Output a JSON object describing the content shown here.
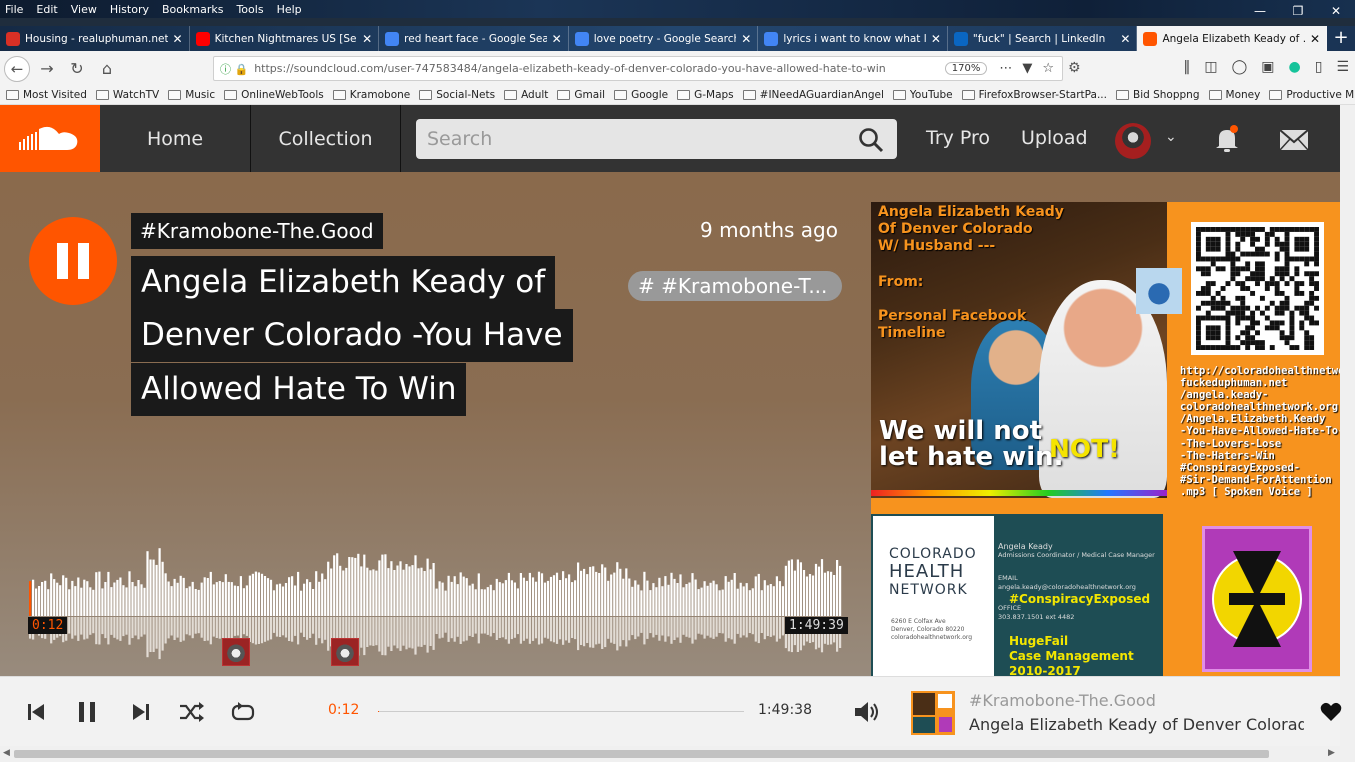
{
  "browser": {
    "menu": [
      "File",
      "Edit",
      "View",
      "History",
      "Bookmarks",
      "Tools",
      "Help"
    ],
    "tabs": [
      {
        "title": "Housing - realuphuman.net@...",
        "favicon": "gmail-icon",
        "color": "#d93025"
      },
      {
        "title": "Kitchen Nightmares US [Se...",
        "favicon": "youtube-icon",
        "color": "#ff0000"
      },
      {
        "title": "red heart face - Google Search",
        "favicon": "google-icon",
        "color": "#4285f4"
      },
      {
        "title": "love poetry - Google Search",
        "favicon": "google-icon",
        "color": "#4285f4"
      },
      {
        "title": "lyrics i want to know what lov...",
        "favicon": "google-icon",
        "color": "#4285f4"
      },
      {
        "title": "\"fuck\" | Search | LinkedIn",
        "favicon": "linkedin-icon",
        "color": "#0a66c2"
      },
      {
        "title": "Angela Elizabeth Keady of ...",
        "favicon": "soundcloud-icon",
        "color": "#ff5500"
      }
    ],
    "url": "https://soundcloud.com/user-747583484/angela-elizabeth-keady-of-denver-colorado-you-have-allowed-hate-to-win",
    "zoom": "170%",
    "bookmarks": [
      "Most Visited",
      "WatchTV",
      "Music",
      "OnlineWebTools",
      "Kramobone",
      "Social-Nets",
      "Adult",
      "Gmail",
      "Google",
      "G-Maps",
      "#INeedAGuardianAngel",
      "YouTube",
      "FirefoxBrowser-StartPa...",
      "Bid Shoppng",
      "Money",
      "Productive Mind Gam..."
    ]
  },
  "header": {
    "nav_home": "Home",
    "nav_collection": "Collection",
    "search_placeholder": "Search",
    "try_pro": "Try Pro",
    "upload": "Upload",
    "brand_color": "#ff5500"
  },
  "track": {
    "artist": "#Kramobone-The.Good",
    "title_lines": [
      "Angela Elizabeth Keady of",
      "Denver Colorado -You Have",
      "Allowed Hate To Win"
    ],
    "posted": "9 months ago",
    "tag": "# #Kramobone-T...",
    "current_time": "0:12",
    "duration": "1:49:39",
    "progress": 0.0018
  },
  "artwork": {
    "heading_lines": [
      "Angela Elizabeth Keady",
      "Of Denver Colorado",
      "W/ Husband ---"
    ],
    "from_label": "From:",
    "source_lines": [
      "Personal Facebook",
      "Timeline"
    ],
    "slogan_1": "We will not",
    "slogan_2": "let hate win.",
    "slogan_not": "NOT!",
    "qr_caption": "http://coloradohealthnetwork\nfuckeduphuman.net\n/angela.keady-\ncoloradohealthnetwork.org\n/Angela.Elizabeth.Keady\n-You-Have-Allowed-Hate-To-\n-The-Lovers-Lose\n-The-Haters-Win\n#ConspiracyExposed-\n#Sir-Demand-ForAttention\n.mp3 [ Spoken Voice ]",
    "card_org_1": "COLORADO",
    "card_org_2": "HEALTH",
    "card_org_3": "NETWORK",
    "card_address": "6260 E Colfax Ave\nDenver, Colorado 80220\ncoloradohealthnetwork.org",
    "card_name": "Angela Keady",
    "card_role": "Admissions Coordinator / Medical Case Manager",
    "card_email_label": "EMAIL",
    "card_email": "angela.keady@coloradohealthnetwork.org",
    "card_office_label": "OFFICE",
    "card_phone": "303.837.1501 ext 4482",
    "card_tag": "#ConspiracyExposed",
    "card_fail": "HugeFail",
    "card_cm": "Case Management",
    "card_years": "2010-2017"
  },
  "player": {
    "current_time": "0:12",
    "duration": "1:49:38",
    "artist": "#Kramobone-The.Good",
    "title": "Angela Elizabeth Keady of Denver Colorado -You Have Allowed Hate To Win",
    "progress": 0.0018
  }
}
